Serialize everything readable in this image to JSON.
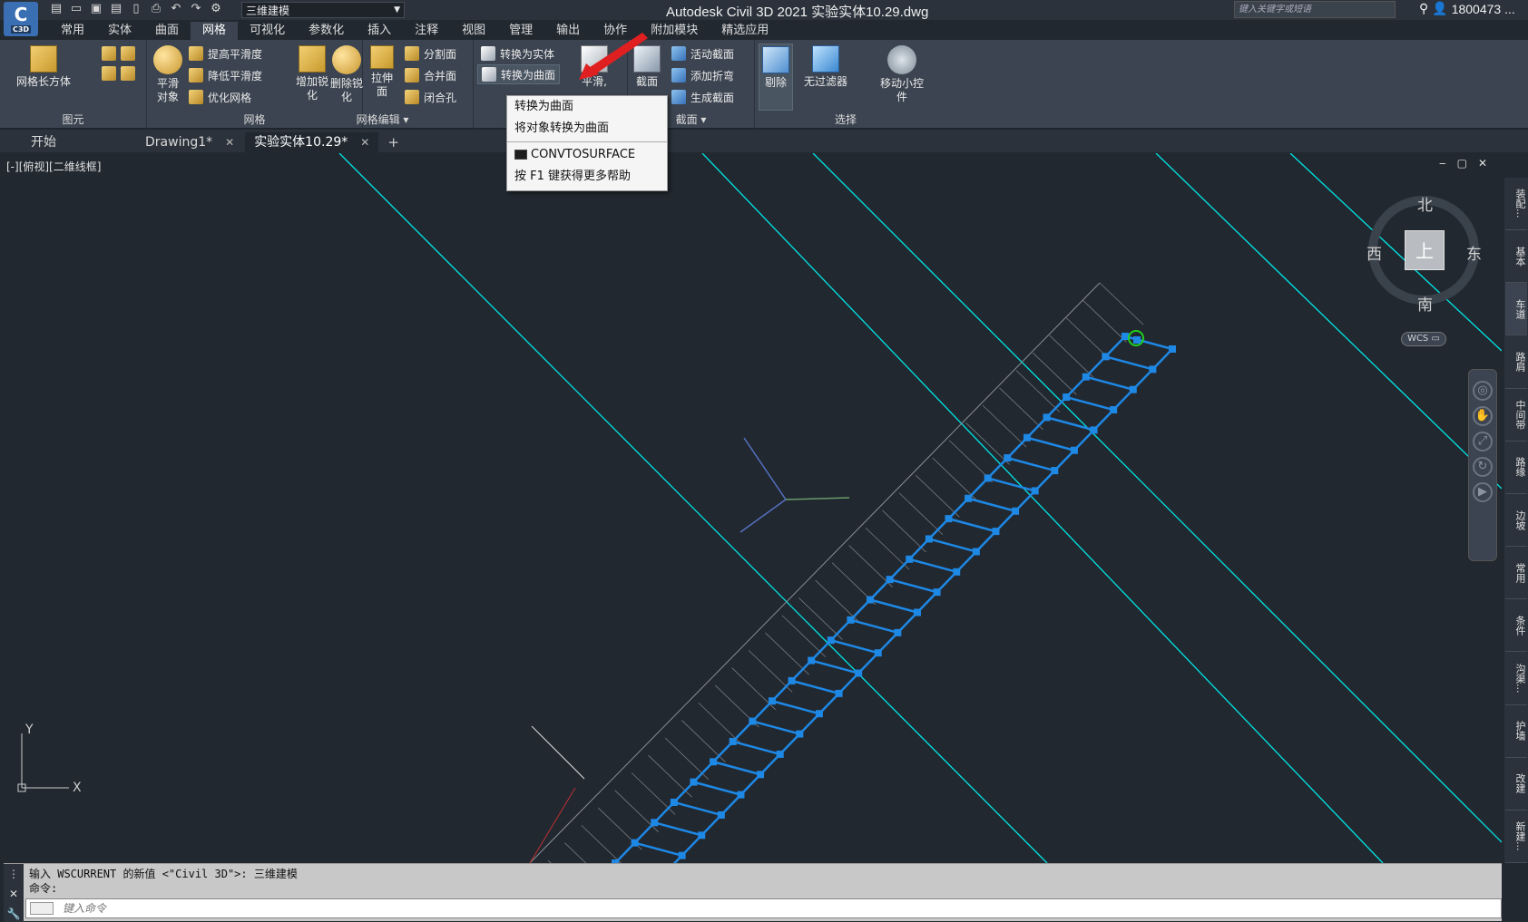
{
  "app": {
    "logo_letter": "C",
    "logo_tag": "C3D",
    "title": "Autodesk Civil 3D 2021    实验实体10.29.dwg"
  },
  "workspace": {
    "value": "三维建模"
  },
  "search": {
    "placeholder": "键入关键字或短语"
  },
  "user": {
    "name": "1800473 ..."
  },
  "menu_tabs": [
    "常用",
    "实体",
    "曲面",
    "网格",
    "可视化",
    "参数化",
    "插入",
    "注释",
    "视图",
    "管理",
    "输出",
    "协作",
    "附加模块",
    "精选应用"
  ],
  "ribbon": {
    "primitives": {
      "box_label": "网格长方体",
      "title": "图元"
    },
    "mesh": {
      "smooth_object": "平滑对象",
      "smooth_more": "提高平滑度",
      "smooth_less": "降低平滑度",
      "refine": "优化网格",
      "title": "网格"
    },
    "mesh_edit": {
      "add_crease": "增加锐化",
      "remove_crease": "删除锐化",
      "extrude": "拉伸面",
      "split": "分割面",
      "merge": "合并面",
      "close_hole": "闭合孔",
      "title": "网格编辑 ▾"
    },
    "convert": {
      "to_solid": "转换为实体",
      "to_surface": "转换为曲面",
      "smooth": "平滑,"
    },
    "section": {
      "plane": "截面",
      "live": "活动截面",
      "add_jog": "添加折弯",
      "generate": "生成截面",
      "title": "截面 ▾"
    },
    "selection": {
      "culling": "剔除",
      "no_filter": "无过滤器",
      "gizmo": "移动小控件",
      "title": "选择"
    }
  },
  "doc_tabs": [
    {
      "label": "开始"
    },
    {
      "label": "Drawing1*"
    },
    {
      "label": "实验实体10.29*"
    }
  ],
  "viewport": {
    "label": "[-][俯视][二维线框]",
    "ctrl_min": "‒",
    "ctrl_max": "▢",
    "ctrl_close": "✕"
  },
  "tooltip": {
    "line1": "转换为曲面",
    "line2": "将对象转换为曲面",
    "command": "CONVTOSURFACE",
    "help": "按 F1 键获得更多帮助"
  },
  "viewcube": {
    "north": "北",
    "south": "南",
    "east": "东",
    "west": "西",
    "face": "上",
    "wcs": "WCS ▭"
  },
  "ucs": {
    "x": "X",
    "y": "Y"
  },
  "right_tabs": [
    "装配...",
    "基本",
    "车道",
    "路肩",
    "中间带",
    "路缘",
    "边坡",
    "常用",
    "条件",
    "沟渠...",
    "护墙",
    "改建",
    "新建..."
  ],
  "cmdline": {
    "history1": "输入 WSCURRENT 的新值 <\"Civil 3D\">: 三维建模",
    "history2": "命令:",
    "placeholder": "键入命令"
  },
  "colors": {
    "cyan": "#00e5e5",
    "mesh_blue": "#1e88e5",
    "bg": "#212830"
  }
}
